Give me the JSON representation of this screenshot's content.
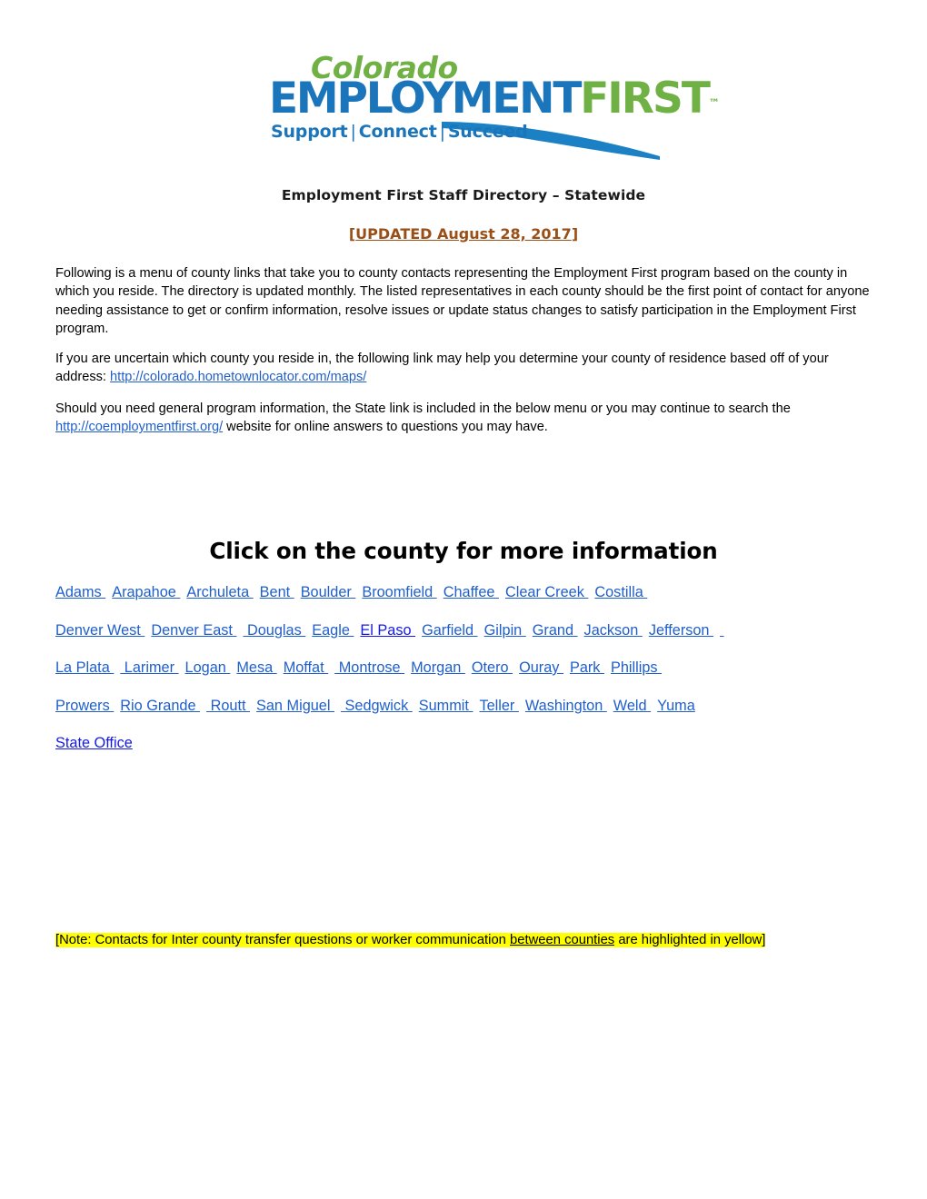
{
  "logo": {
    "word_colorado": "Colorado",
    "word_employment": "EMPLOYMENT",
    "word_first": "FIRST",
    "trademark": "™",
    "tagline_support": "Support",
    "tagline_connect": "Connect",
    "tagline_succeed": "Succeed",
    "tagline_separator": "|",
    "color_green": "#6fb144",
    "color_blue": "#1b75bb"
  },
  "header": {
    "title": "Employment First Staff Directory – Statewide",
    "updated_open_bracket": "[",
    "updated_text": "UPDATED August 28, 2017",
    "updated_close_bracket": "]",
    "updated_color": "#9a4f17"
  },
  "intro": {
    "paragraph": "Following is a menu of county links that take you to county contacts representing the Employment First program based on the county in which you reside.  The directory is updated monthly. The listed representatives in each county should be the first point of contact for anyone needing assistance to get or confirm information, resolve issues or update status changes to satisfy participation in the Employment First program."
  },
  "county_lookup": {
    "text_before": "If you are uncertain which county you reside in, the following link may help you determine your county of residence based off of your address: ",
    "link_text": "http://colorado.hometownlocator.com/maps/"
  },
  "state_info": {
    "text_before": "Should you need general program information, the State link is included in the below menu or you may continue to search the ",
    "link_text": "http://coemploymentfirst.org/",
    "text_after": " website for online answers to questions you may have."
  },
  "menu": {
    "heading": "Click on the county for more information",
    "link_color": "#1f5fcc",
    "link_color_bright": "#1419e8",
    "rows": [
      [
        {
          "label": "Adams "
        },
        {
          "label": "Arapahoe "
        },
        {
          "label": "Archuleta "
        },
        {
          "label": "Bent "
        },
        {
          "label": "Boulder "
        },
        {
          "label": "Broomfield "
        },
        {
          "label": "Chaffee "
        },
        {
          "label": "Clear Creek "
        },
        {
          "label": "Costilla "
        }
      ],
      [
        {
          "label": "Denver West "
        },
        {
          "label": "Denver East "
        },
        {
          "label": " Douglas "
        },
        {
          "label": "Eagle "
        },
        {
          "label": "El Paso ",
          "bright": true
        },
        {
          "label": "Garfield "
        },
        {
          "label": "Gilpin "
        },
        {
          "label": "Grand "
        },
        {
          "label": "Jackson "
        },
        {
          "label": "Jefferson "
        },
        {
          "label": " "
        }
      ],
      [
        {
          "label": "La Plata "
        },
        {
          "label": " Larimer "
        },
        {
          "label": "Logan "
        },
        {
          "label": "Mesa "
        },
        {
          "label": "Moffat "
        },
        {
          "label": " Montrose "
        },
        {
          "label": "Morgan "
        },
        {
          "label": "Otero "
        },
        {
          "label": "Ouray "
        },
        {
          "label": "Park "
        },
        {
          "label": "Phillips "
        }
      ],
      [
        {
          "label": "Prowers "
        },
        {
          "label": "Rio Grande "
        },
        {
          "label": " Routt "
        },
        {
          "label": "San Miguel "
        },
        {
          "label": " Sedgwick "
        },
        {
          "label": "Summit "
        },
        {
          "label": "Teller "
        },
        {
          "label": "Washington "
        },
        {
          "label": "Weld "
        },
        {
          "label": "Yuma"
        }
      ]
    ],
    "state_office": "State Office"
  },
  "note": {
    "part1": "[Note:  Contacts for Inter county transfer questions or worker communication ",
    "part2_underlined": "between counties",
    "part3": " are highlighted in yellow]",
    "highlight_color": "#ffff00"
  }
}
